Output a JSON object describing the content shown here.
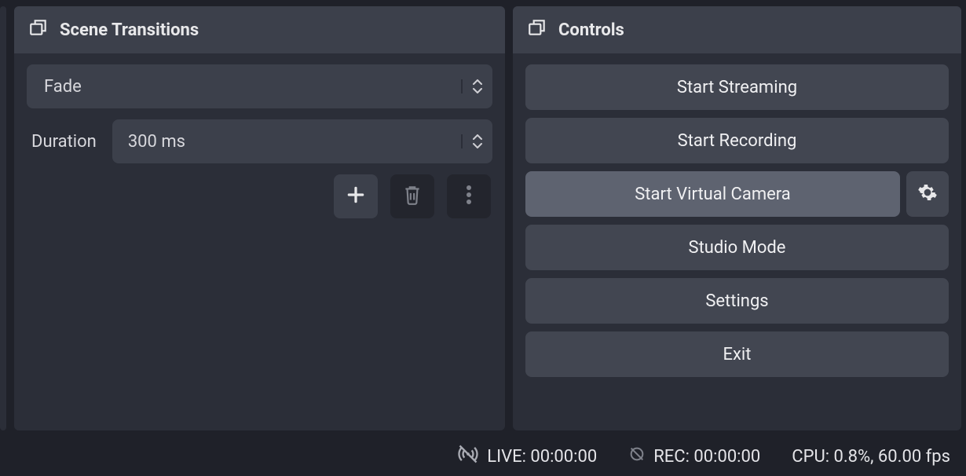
{
  "transitions": {
    "title": "Scene Transitions",
    "current": "Fade",
    "duration_label": "Duration",
    "duration_value": "300 ms"
  },
  "controls": {
    "title": "Controls",
    "buttons": {
      "start_streaming": "Start Streaming",
      "start_recording": "Start Recording",
      "start_virtual_camera": "Start Virtual Camera",
      "studio_mode": "Studio Mode",
      "settings": "Settings",
      "exit": "Exit"
    }
  },
  "status": {
    "live": "LIVE: 00:00:00",
    "rec": "REC: 00:00:00",
    "cpu": "CPU: 0.8%, 60.00 fps"
  }
}
